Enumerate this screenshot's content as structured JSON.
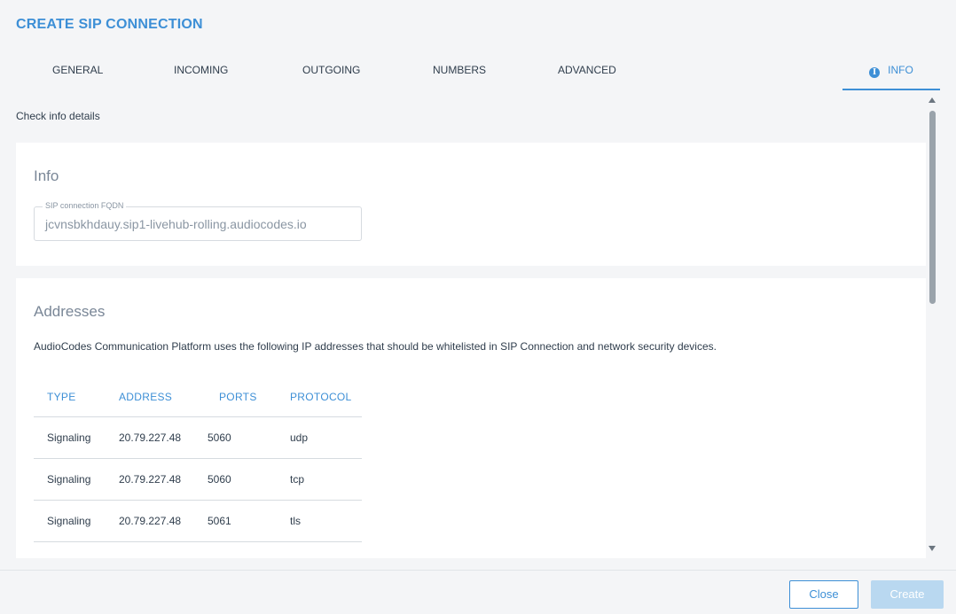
{
  "dialog": {
    "title": "CREATE SIP CONNECTION"
  },
  "tabs": [
    {
      "label": "GENERAL"
    },
    {
      "label": "INCOMING"
    },
    {
      "label": "OUTGOING"
    },
    {
      "label": "NUMBERS"
    },
    {
      "label": "ADVANCED"
    },
    {
      "label": "INFO",
      "icon": "info-icon",
      "active": true
    }
  ],
  "subtitle": "Check info details",
  "info_card": {
    "title": "Info",
    "fqdn_label": "SIP connection FQDN",
    "fqdn_value": "jcvnsbkhdauy.sip1-livehub-rolling.audiocodes.io"
  },
  "addresses_card": {
    "title": "Addresses",
    "description": "AudioCodes Communication Platform uses the following IP addresses that should be whitelisted in SIP Connection and network security devices.",
    "columns": [
      "TYPE",
      "ADDRESS",
      "PORTS",
      "PROTOCOL"
    ],
    "rows": [
      [
        "Signaling",
        "20.79.227.48",
        "5060",
        "udp"
      ],
      [
        "Signaling",
        "20.79.227.48",
        "5060",
        "tcp"
      ],
      [
        "Signaling",
        "20.79.227.48",
        "5061",
        "tls"
      ]
    ]
  },
  "footer": {
    "close_label": "Close",
    "create_label": "Create"
  },
  "colors": {
    "accent": "#3d8fd6",
    "disabled_button": "#b9d8f0",
    "background": "#f4f5f7"
  }
}
